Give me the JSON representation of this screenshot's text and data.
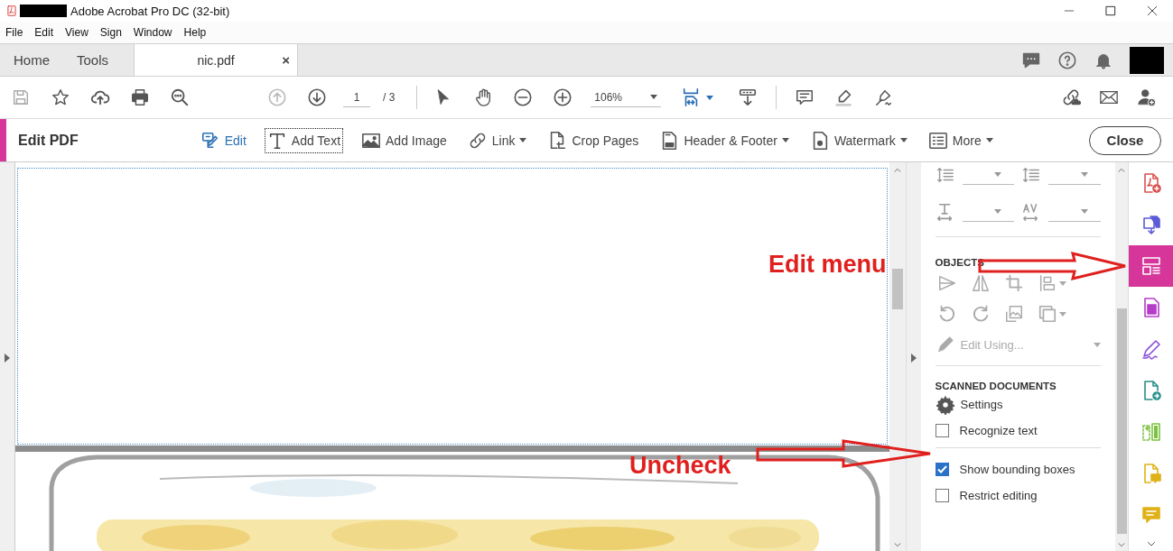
{
  "window": {
    "title": "Adobe Acrobat Pro DC (32-bit)"
  },
  "menu": [
    "File",
    "Edit",
    "View",
    "Sign",
    "Window",
    "Help"
  ],
  "tabs": [
    {
      "label": "Home",
      "selected": false
    },
    {
      "label": "Tools",
      "selected": false
    },
    {
      "label": "nic.pdf",
      "selected": true,
      "close": "×"
    }
  ],
  "toolbar": {
    "prev_page_disabled": true,
    "page": "1",
    "page_total": "/ 3",
    "zoom": "106%"
  },
  "edit_bar": {
    "title": "Edit PDF",
    "tools": [
      {
        "label": "Edit",
        "active": true,
        "focused": false,
        "dropdown": false
      },
      {
        "label": "Add Text",
        "active": false,
        "focused": true,
        "dropdown": false
      },
      {
        "label": "Add Image",
        "active": false,
        "focused": false,
        "dropdown": false
      },
      {
        "label": "Link",
        "active": false,
        "focused": false,
        "dropdown": true
      },
      {
        "label": "Crop Pages",
        "active": false,
        "focused": false,
        "dropdown": false
      },
      {
        "label": "Header & Footer",
        "active": false,
        "focused": false,
        "dropdown": true
      },
      {
        "label": "Watermark",
        "active": false,
        "focused": false,
        "dropdown": true
      },
      {
        "label": "More",
        "active": false,
        "focused": false,
        "dropdown": true
      }
    ],
    "close": "Close"
  },
  "panel": {
    "objects": {
      "title": "OBJECTS",
      "disabled": true,
      "edit_using": "Edit Using..."
    },
    "scanned": {
      "title": "SCANNED DOCUMENTS",
      "settings": "Settings",
      "options": [
        {
          "label": "Recognize text",
          "checked": false
        }
      ]
    },
    "options": [
      {
        "label": "Show bounding boxes",
        "checked": true
      },
      {
        "label": "Restrict editing",
        "checked": false
      }
    ]
  },
  "rail": [
    {
      "color": "#d9534f",
      "selected": false
    },
    {
      "color": "#5b5bd6",
      "selected": false
    },
    {
      "color": "#d6359a",
      "selected": true
    },
    {
      "color": "#b43cc8",
      "selected": false
    },
    {
      "color": "#8a4fd6",
      "selected": false
    },
    {
      "color": "#27908a",
      "selected": false
    },
    {
      "color": "#7cc242",
      "selected": false
    },
    {
      "color": "#e0b21a",
      "selected": false
    },
    {
      "color": "#e0b21a",
      "selected": false
    }
  ],
  "annotations": [
    {
      "text": "Edit menu"
    },
    {
      "text": "Uncheck"
    }
  ]
}
